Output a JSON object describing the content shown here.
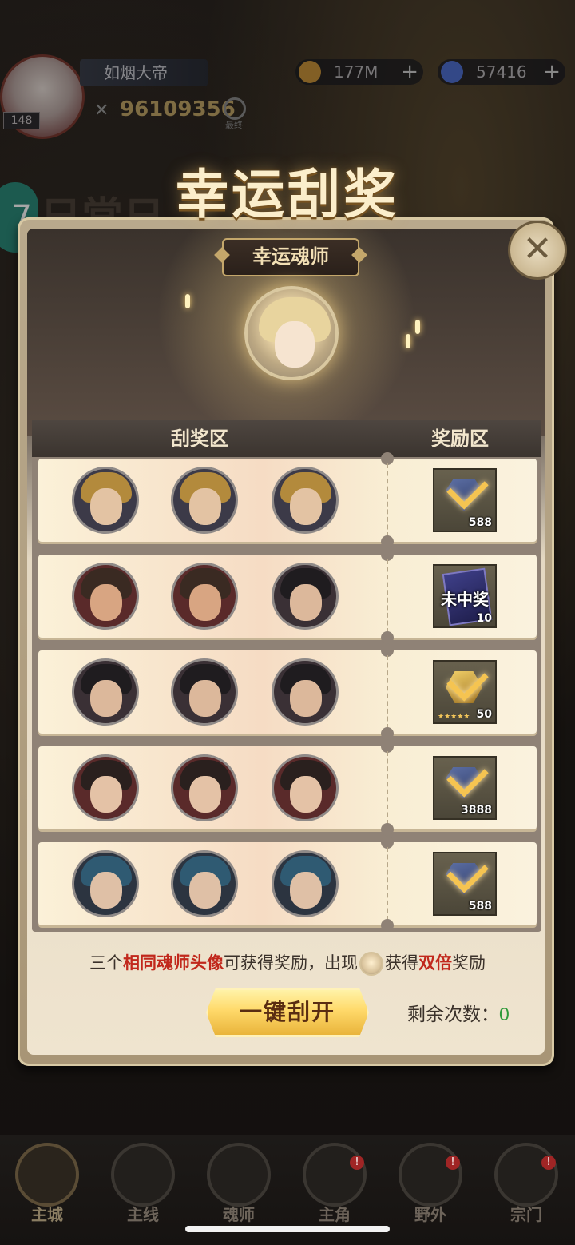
{
  "player": {
    "name": "如烟大帝",
    "level": "148",
    "power": "96109356",
    "search_label": "最终"
  },
  "currencies": [
    {
      "name": "gold-coin",
      "value": "177M",
      "color": "#d9a23a"
    },
    {
      "name": "diamond",
      "value": "57416",
      "color": "#5b7dd8"
    }
  ],
  "background": {
    "badge_text": "7",
    "title_text": "日常日"
  },
  "modal": {
    "title": "幸运刮奖",
    "lucky_tag": "幸运魂师",
    "close_symbol": "✕",
    "columns": {
      "scratch": "刮奖区",
      "reward": "奖励区"
    },
    "rows": [
      {
        "avatars": [
          "gold-hair-man",
          "gold-hair-man",
          "gold-hair-man"
        ],
        "reward": {
          "type": "diamond",
          "qty": "588",
          "status": "claimed"
        }
      },
      {
        "avatars": [
          "bearded-warrior",
          "bearded-warrior",
          "dark-hair-man"
        ],
        "reward": {
          "type": "card",
          "qty": "10",
          "status": "未中奖"
        }
      },
      {
        "avatars": [
          "dark-hair-man",
          "dark-hair-man",
          "dark-hair-man"
        ],
        "reward": {
          "type": "gold-gem",
          "qty": "50",
          "status": "claimed",
          "stars": "★★★★★"
        }
      },
      {
        "avatars": [
          "long-hair-swordsman",
          "long-hair-swordsman",
          "long-hair-swordsman"
        ],
        "reward": {
          "type": "diamond",
          "qty": "3888",
          "status": "claimed"
        }
      },
      {
        "avatars": [
          "blue-hair-mage",
          "blue-hair-mage",
          "blue-hair-mage"
        ],
        "reward": {
          "type": "diamond",
          "qty": "588",
          "status": "claimed"
        }
      }
    ],
    "hint": {
      "part1": "三个",
      "part2": "相同魂师头像",
      "part3": "可获得奖励，出现",
      "part4": "获得",
      "part5": "双倍",
      "part6": "奖励"
    },
    "scratch_button": "一键刮开",
    "remaining_label": "剩余次数：",
    "remaining_count": "0"
  },
  "nav": [
    {
      "label": "主城",
      "icon": "castle-icon",
      "active": true,
      "badge": ""
    },
    {
      "label": "主线",
      "icon": "mainline-icon",
      "active": false,
      "badge": ""
    },
    {
      "label": "魂师",
      "icon": "book-icon",
      "active": false,
      "badge": ""
    },
    {
      "label": "主角",
      "icon": "hero-icon",
      "active": false,
      "badge": "!"
    },
    {
      "label": "野外",
      "icon": "sword-icon",
      "active": false,
      "badge": "!"
    },
    {
      "label": "宗门",
      "icon": "sect-icon",
      "active": false,
      "badge": "!"
    }
  ]
}
